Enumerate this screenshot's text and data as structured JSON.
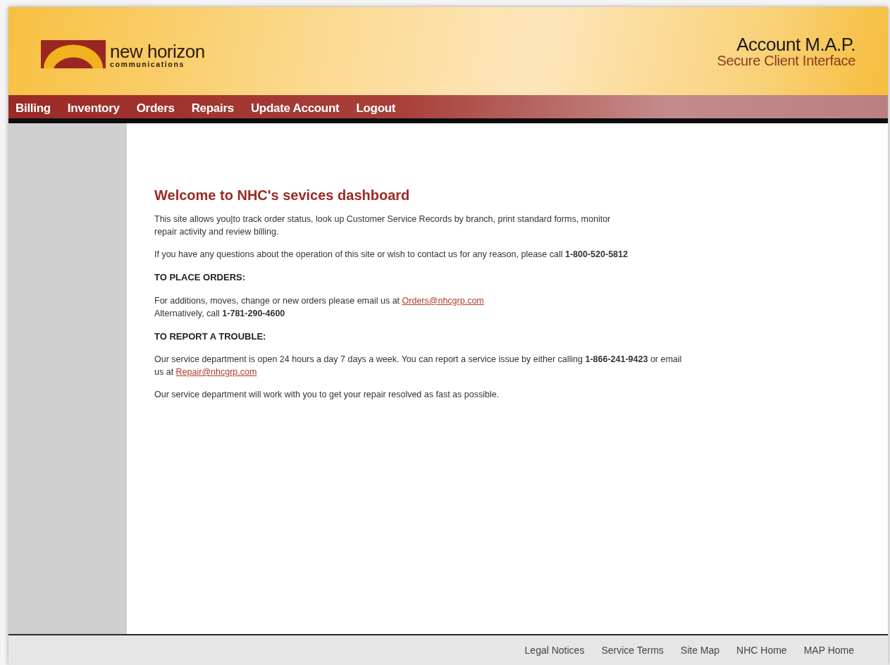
{
  "logo": {
    "name": "new horizon",
    "tagline": "communications"
  },
  "product": {
    "title": "Account M.A.P.",
    "subtitle": "Secure Client Interface"
  },
  "nav": [
    "Billing",
    "Inventory",
    "Orders",
    "Repairs",
    "Update Account",
    "Logout"
  ],
  "content": {
    "title": "Welcome to NHC's sevices dashboard",
    "blocks": [
      {
        "kind": "paragraph",
        "lines": [
          [
            {
              "kind": "text",
              "text": "This site allows you|to track order status, look up Customer Service Records by branch, print standard forms, monitor"
            }
          ],
          [
            {
              "kind": "text",
              "text": "repair activity and review billing."
            }
          ]
        ]
      },
      {
        "kind": "paragraph",
        "lines": [
          [
            {
              "kind": "text",
              "text": "If you have any questions about the operation of this site or wish to contact us for any reason, please call **1-800-520-5812**"
            }
          ]
        ]
      },
      {
        "kind": "heading",
        "text": "TO PLACE ORDERS:"
      },
      {
        "kind": "paragraph",
        "lines": [
          [
            {
              "kind": "text",
              "text": "For additions, moves, change or new orders please email us at "
            },
            {
              "kind": "link",
              "text": "Orders@nhcgrp.com"
            }
          ],
          [
            {
              "kind": "text",
              "text": "Alternatively, call **1-781-290-4600**"
            }
          ]
        ]
      },
      {
        "kind": "heading",
        "text": "TO REPORT A TROUBLE:"
      },
      {
        "kind": "paragraph",
        "lines": [
          [
            {
              "kind": "text",
              "text": "Our service department is open 24 hours a day 7 days a week. You can report a service issue by either calling **1-866-241-9423** or email"
            }
          ],
          [
            {
              "kind": "text",
              "text": "us at "
            },
            {
              "kind": "link",
              "text": "Repair@nhcgrp.com"
            }
          ]
        ]
      },
      {
        "kind": "paragraph",
        "lines": [
          [
            {
              "kind": "text",
              "text": "Our service department will work with you to get your repair resolved as fast as possible."
            }
          ]
        ]
      }
    ]
  },
  "footer": [
    "Legal Notices",
    "Service Terms",
    "Site Map",
    "NHC Home",
    "MAP Home"
  ]
}
